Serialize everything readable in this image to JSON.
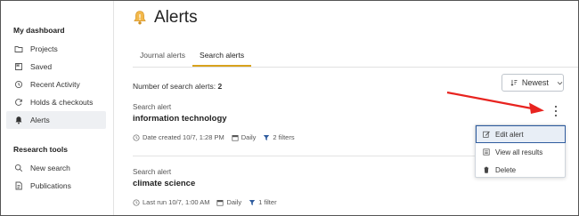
{
  "sidebar": {
    "heading_dashboard": "My dashboard",
    "dashboard_items": [
      {
        "label": "Projects",
        "icon": "folder-icon"
      },
      {
        "label": "Saved",
        "icon": "bookmark-icon"
      },
      {
        "label": "Recent Activity",
        "icon": "history-icon"
      },
      {
        "label": "Holds & checkouts",
        "icon": "refresh-icon"
      },
      {
        "label": "Alerts",
        "icon": "bell-icon",
        "active": true
      }
    ],
    "heading_research": "Research tools",
    "research_items": [
      {
        "label": "New search",
        "icon": "search-icon"
      },
      {
        "label": "Publications",
        "icon": "document-icon"
      }
    ]
  },
  "main": {
    "title": "Alerts",
    "tabs": [
      {
        "label": "Journal alerts",
        "active": false
      },
      {
        "label": "Search alerts",
        "active": true
      }
    ],
    "count_label": "Number of search alerts:",
    "count_value": "2",
    "sort": {
      "label": "Newest"
    },
    "alerts": [
      {
        "type_label": "Search alert",
        "title": "information technology",
        "date": "Date created 10/7, 1:28 PM",
        "frequency": "Daily",
        "filters": "2 filters"
      },
      {
        "type_label": "Search alert",
        "title": "climate science",
        "date": "Last run 10/7, 1:00 AM",
        "frequency": "Daily",
        "filters": "1 filter"
      }
    ],
    "menu": {
      "items": [
        {
          "label": "Edit alert",
          "icon": "edit-icon"
        },
        {
          "label": "View all results",
          "icon": "list-icon"
        },
        {
          "label": "Delete",
          "icon": "trash-icon"
        }
      ]
    }
  },
  "colors": {
    "accent": "#d8a21c",
    "menu_highlight_border": "#2f5c9e",
    "annotation_arrow": "#e8231f"
  }
}
